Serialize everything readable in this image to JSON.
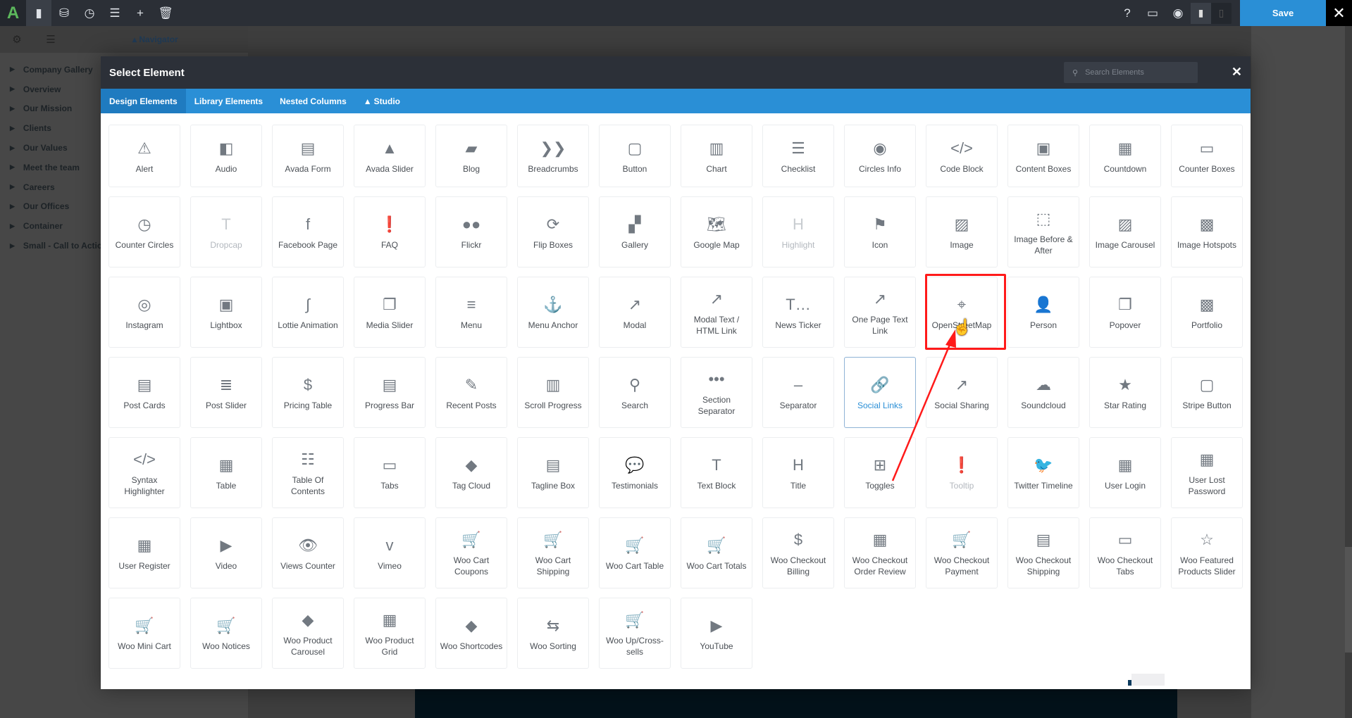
{
  "topbar": {
    "tools": [
      {
        "name": "toggle-sidebar-icon",
        "glyph": "▮"
      },
      {
        "name": "library-icon",
        "glyph": "⛁"
      },
      {
        "name": "history-icon",
        "glyph": "◷"
      },
      {
        "name": "layout-icon",
        "glyph": "☰"
      },
      {
        "name": "add-icon",
        "glyph": "+"
      },
      {
        "name": "trash-icon",
        "glyph": "🗑"
      }
    ],
    "save_label": "Save",
    "close_glyph": "✕"
  },
  "left_panel": {
    "navigator_label": "Navigator",
    "items": [
      "Company Gallery",
      "Overview",
      "Our Mission",
      "Clients",
      "Our Values",
      "Meet the team",
      "Careers",
      "Our Offices",
      "Container",
      "Small - Call to Action"
    ]
  },
  "modal": {
    "title": "Select Element",
    "search_placeholder": "Search Elements",
    "close_glyph": "✕",
    "tabs": [
      {
        "label": "Design Elements",
        "active": true
      },
      {
        "label": "Library Elements"
      },
      {
        "label": "Nested Columns"
      },
      {
        "label": "Studio",
        "icon": "avada-icon"
      }
    ],
    "elements": [
      {
        "label": "Alert",
        "icon": "⚠"
      },
      {
        "label": "Audio",
        "icon": "◧"
      },
      {
        "label": "Avada Form",
        "icon": "▤"
      },
      {
        "label": "Avada Slider",
        "icon": "▲"
      },
      {
        "label": "Blog",
        "icon": "▰"
      },
      {
        "label": "Breadcrumbs",
        "icon": "❯❯"
      },
      {
        "label": "Button",
        "icon": "▢"
      },
      {
        "label": "Chart",
        "icon": "▥"
      },
      {
        "label": "Checklist",
        "icon": "☰"
      },
      {
        "label": "Circles Info",
        "icon": "◉"
      },
      {
        "label": "Code Block",
        "icon": "</>"
      },
      {
        "label": "Content Boxes",
        "icon": "▣"
      },
      {
        "label": "Countdown",
        "icon": "▦"
      },
      {
        "label": "Counter Boxes",
        "icon": "▭"
      },
      {
        "label": "Counter Circles",
        "icon": "◷"
      },
      {
        "label": "Dropcap",
        "icon": "T",
        "state": "disabled"
      },
      {
        "label": "Facebook Page",
        "icon": "f"
      },
      {
        "label": "FAQ",
        "icon": "❗"
      },
      {
        "label": "Flickr",
        "icon": "●●"
      },
      {
        "label": "Flip Boxes",
        "icon": "⟳"
      },
      {
        "label": "Gallery",
        "icon": "▞"
      },
      {
        "label": "Google Map",
        "icon": "🗺"
      },
      {
        "label": "Highlight",
        "icon": "H",
        "state": "disabled"
      },
      {
        "label": "Icon",
        "icon": "⚑"
      },
      {
        "label": "Image",
        "icon": "▨"
      },
      {
        "label": "Image Before & After",
        "icon": "⬚"
      },
      {
        "label": "Image Carousel",
        "icon": "▨"
      },
      {
        "label": "Image Hotspots",
        "icon": "▩"
      },
      {
        "label": "Instagram",
        "icon": "◎"
      },
      {
        "label": "Lightbox",
        "icon": "▣"
      },
      {
        "label": "Lottie Animation",
        "icon": "∫"
      },
      {
        "label": "Media Slider",
        "icon": "❐"
      },
      {
        "label": "Menu",
        "icon": "≡"
      },
      {
        "label": "Menu Anchor",
        "icon": "⚓"
      },
      {
        "label": "Modal",
        "icon": "↗"
      },
      {
        "label": "Modal Text / HTML Link",
        "icon": "↗"
      },
      {
        "label": "News Ticker",
        "icon": "T…"
      },
      {
        "label": "One Page Text Link",
        "icon": "↗"
      },
      {
        "label": "OpenStreetMap",
        "icon": "⌖"
      },
      {
        "label": "Person",
        "icon": "👤"
      },
      {
        "label": "Popover",
        "icon": "❐"
      },
      {
        "label": "Portfolio",
        "icon": "▩"
      },
      {
        "label": "Post Cards",
        "icon": "▤"
      },
      {
        "label": "Post Slider",
        "icon": "≣"
      },
      {
        "label": "Pricing Table",
        "icon": "$"
      },
      {
        "label": "Progress Bar",
        "icon": "▤"
      },
      {
        "label": "Recent Posts",
        "icon": "✎"
      },
      {
        "label": "Scroll Progress",
        "icon": "▥"
      },
      {
        "label": "Search",
        "icon": "⚲"
      },
      {
        "label": "Section Separator",
        "icon": "•••"
      },
      {
        "label": "Separator",
        "icon": "–"
      },
      {
        "label": "Social Links",
        "icon": "🔗",
        "state": "active"
      },
      {
        "label": "Social Sharing",
        "icon": "↗"
      },
      {
        "label": "Soundcloud",
        "icon": "☁"
      },
      {
        "label": "Star Rating",
        "icon": "★"
      },
      {
        "label": "Stripe Button",
        "icon": "▢"
      },
      {
        "label": "Syntax Highlighter",
        "icon": "</>"
      },
      {
        "label": "Table",
        "icon": "▦"
      },
      {
        "label": "Table Of Contents",
        "icon": "☷"
      },
      {
        "label": "Tabs",
        "icon": "▭"
      },
      {
        "label": "Tag Cloud",
        "icon": "◆"
      },
      {
        "label": "Tagline Box",
        "icon": "▤"
      },
      {
        "label": "Testimonials",
        "icon": "💬"
      },
      {
        "label": "Text Block",
        "icon": "T"
      },
      {
        "label": "Title",
        "icon": "H"
      },
      {
        "label": "Toggles",
        "icon": "⊞"
      },
      {
        "label": "Tooltip",
        "icon": "❗",
        "state": "disabled"
      },
      {
        "label": "Twitter Timeline",
        "icon": "🐦"
      },
      {
        "label": "User Login",
        "icon": "▦"
      },
      {
        "label": "User Lost Password",
        "icon": "▦"
      },
      {
        "label": "User Register",
        "icon": "▦"
      },
      {
        "label": "Video",
        "icon": "▶"
      },
      {
        "label": "Views Counter",
        "icon": "👁"
      },
      {
        "label": "Vimeo",
        "icon": "v"
      },
      {
        "label": "Woo Cart Coupons",
        "icon": "🛒"
      },
      {
        "label": "Woo Cart Shipping",
        "icon": "🛒"
      },
      {
        "label": "Woo Cart Table",
        "icon": "🛒"
      },
      {
        "label": "Woo Cart Totals",
        "icon": "🛒"
      },
      {
        "label": "Woo Checkout Billing",
        "icon": "$"
      },
      {
        "label": "Woo Checkout Order Review",
        "icon": "▦"
      },
      {
        "label": "Woo Checkout Payment",
        "icon": "🛒"
      },
      {
        "label": "Woo Checkout Shipping",
        "icon": "▤"
      },
      {
        "label": "Woo Checkout Tabs",
        "icon": "▭"
      },
      {
        "label": "Woo Featured Products Slider",
        "icon": "☆"
      },
      {
        "label": "Woo Mini Cart",
        "icon": "🛒"
      },
      {
        "label": "Woo Notices",
        "icon": "🛒"
      },
      {
        "label": "Woo Product Carousel",
        "icon": "◆"
      },
      {
        "label": "Woo Product Grid",
        "icon": "▦"
      },
      {
        "label": "Woo Shortcodes",
        "icon": "◆"
      },
      {
        "label": "Woo Sorting",
        "icon": "⇆"
      },
      {
        "label": "Woo Up/Cross-sells",
        "icon": "🛒"
      },
      {
        "label": "YouTube",
        "icon": "▶"
      }
    ]
  },
  "colors": {
    "accent": "#2a8fd6",
    "annotation": "#ff1a1a"
  }
}
